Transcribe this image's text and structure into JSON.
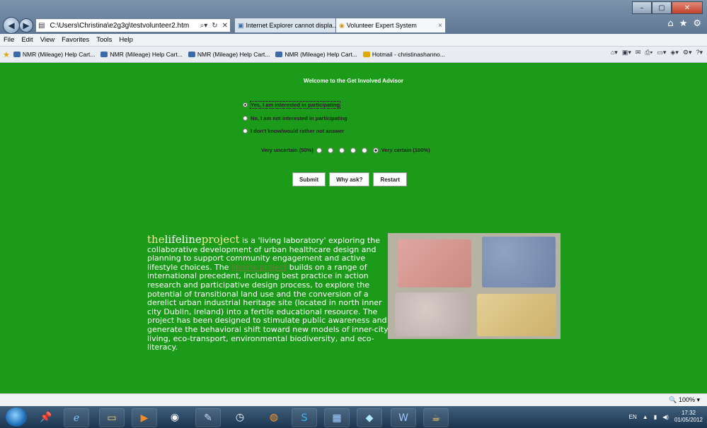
{
  "browser": {
    "address": "C:\\Users\\Christina\\e2g3g\\testvolunteer2.htm",
    "tabs": [
      {
        "label": "Internet Explorer cannot displa..."
      },
      {
        "label": "Volunteer Expert System"
      }
    ],
    "menu": [
      "File",
      "Edit",
      "View",
      "Favorites",
      "Tools",
      "Help"
    ],
    "favorites": [
      "NMR (Mileage) Help Cart...",
      "NMR (Mileage) Help Cart...",
      "NMR (Mileage) Help Cart...",
      "NMR (Mileage) Help Cart...",
      "Hotmail - christinashanno..."
    ]
  },
  "advisor": {
    "welcome": "Welcome to the Get Involved Advisor",
    "options": [
      {
        "label": "Yes, I am interested in participating",
        "selected": true
      },
      {
        "label": "No, I am not interested in participating",
        "selected": false
      },
      {
        "label": "I don't know/would rather not answer",
        "selected": false
      }
    ],
    "certainty": {
      "low_label": "Very uncertain (50%)",
      "high_label": "Very certain (100%)",
      "steps": 6,
      "selected_index": 5
    },
    "buttons": {
      "submit": "Submit",
      "why": "Why ask?",
      "restart": "Restart"
    }
  },
  "lifeline": {
    "brand_part1": "the",
    "brand_part2": "lifeline",
    "brand_part3": "project",
    "text_before_link": " is a 'living laboratory' exploring the collaborative development of urban healthcare design and planning to support community engagement and active lifestyle choices. The ",
    "link_text": "lifeline project",
    "text_after_link": " builds on a range of international precedent, including best practice in action research and participative design process, to explore the potential of transitional land use and the conversion of a derelict urban industrial heritage site (located in north inner city Dublin, Ireland) into a fertile educational resource. The project has been designed to stimulate public awareness and generate the behavioral shift toward new models of inner-city living, eco-transport, environmental biodiversity, and eco-literacy."
  },
  "statusbar": {
    "zoom": "100%"
  },
  "tray": {
    "lang": "EN",
    "time": "17:32",
    "date": "01/05/2012"
  }
}
